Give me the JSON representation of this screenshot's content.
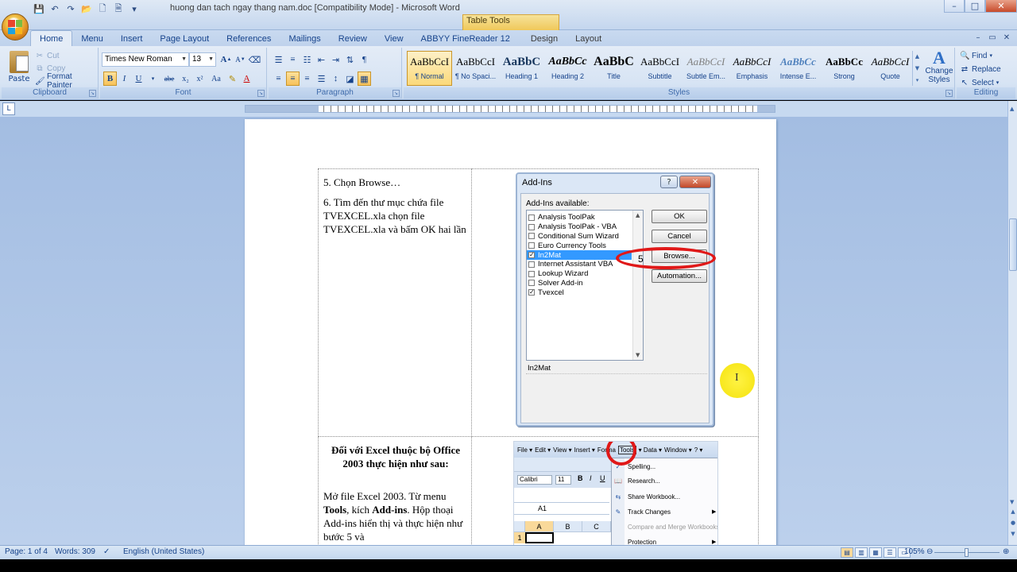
{
  "window": {
    "title": "huong dan tach ngay thang nam.doc [Compatibility Mode] - Microsoft Word",
    "contextual_tab_group": "Table Tools",
    "controls": [
      "–",
      "□",
      "✕"
    ]
  },
  "tabs": [
    {
      "label": "Home",
      "active": true
    },
    {
      "label": "Menu"
    },
    {
      "label": "Insert"
    },
    {
      "label": "Page Layout"
    },
    {
      "label": "References"
    },
    {
      "label": "Mailings"
    },
    {
      "label": "Review"
    },
    {
      "label": "View"
    },
    {
      "label": "ABBYY FineReader 12"
    },
    {
      "label": "Design",
      "contextual": true
    },
    {
      "label": "Layout",
      "contextual": true
    }
  ],
  "ribbon": {
    "clipboard": {
      "label": "Clipboard",
      "paste": "Paste",
      "cut": "Cut",
      "copy": "Copy",
      "format_painter": "Format Painter"
    },
    "font": {
      "label": "Font",
      "font_name": "Times New Roman",
      "font_size": "13",
      "bold": "B",
      "italic": "I",
      "underline": "U",
      "strike": "abe",
      "subscript": "x₂",
      "superscript": "x²",
      "change_case": "Aa",
      "grow": "A",
      "shrink": "A"
    },
    "paragraph": {
      "label": "Paragraph"
    },
    "styles": {
      "label": "Styles",
      "items": [
        {
          "sample": "AaBbCcI",
          "name": "¶ Normal",
          "active": true
        },
        {
          "sample": "AaBbCcI",
          "name": "¶ No Spaci..."
        },
        {
          "sample": "AaBbC",
          "name": "Heading 1"
        },
        {
          "sample": "AaBbCc",
          "name": "Heading 2"
        },
        {
          "sample": "AaBbC",
          "name": "Title"
        },
        {
          "sample": "AaBbCcI",
          "name": "Subtitle"
        },
        {
          "sample": "AaBbCcI",
          "name": "Subtle Em..."
        },
        {
          "sample": "AaBbCcI",
          "name": "Emphasis"
        },
        {
          "sample": "AaBbCc",
          "name": "Intense E..."
        },
        {
          "sample": "AaBbCc",
          "name": "Strong"
        },
        {
          "sample": "AaBbCcI",
          "name": "Quote"
        }
      ],
      "change_styles": "Change Styles"
    },
    "editing": {
      "label": "Editing",
      "find": "Find",
      "replace": "Replace",
      "select": "Select"
    }
  },
  "document": {
    "row1_left": {
      "step5": "5.  Chọn Browse…",
      "step6": "6.  Tìm đến thư mục chứa file TVEXCEL.xla chọn file TVEXCEL.xla và bấm OK hai lần"
    },
    "row2_left": {
      "heading": "Đối với Excel thuộc bộ Office 2003 thực hiện như sau:",
      "body_prefix": "Mở file Excel 2003. Từ menu ",
      "tools": "Tools",
      "body_mid": ", kích ",
      "addins": "Add-ins",
      "body_suffix": ". Hộp thoại Add-ins hiển thị và thực hiện như bước 5 và"
    }
  },
  "addins_dialog": {
    "title": "Add-Ins",
    "help": "?",
    "close": "✕",
    "available_label": "Add-Ins available:",
    "items": [
      {
        "name": "Analysis ToolPak",
        "checked": false
      },
      {
        "name": "Analysis ToolPak - VBA",
        "checked": false
      },
      {
        "name": "Conditional Sum Wizard",
        "checked": false
      },
      {
        "name": "Euro Currency Tools",
        "checked": false
      },
      {
        "name": "In2Mat",
        "checked": true,
        "selected": true
      },
      {
        "name": "Internet Assistant VBA",
        "checked": false
      },
      {
        "name": "Lookup Wizard",
        "checked": false
      },
      {
        "name": "Solver Add-in",
        "checked": false
      },
      {
        "name": "Tvexcel",
        "checked": true
      }
    ],
    "buttons": {
      "ok": "OK",
      "cancel": "Cancel",
      "browse": "Browse...",
      "automation": "Automation..."
    },
    "description": "In2Mat",
    "annotation": "5"
  },
  "excel_snippet": {
    "menu": [
      "File ▾",
      "Edit ▾",
      "View ▾",
      "Insert ▾",
      "Forma",
      "Tools",
      "▾ Data ▾",
      "Window ▾",
      "? ▾"
    ],
    "font": "Calibri",
    "size": "11",
    "bold": "B",
    "italic": "I",
    "underline": "U",
    "namebox": "A1",
    "columns": [
      "A",
      "B",
      "C"
    ],
    "row": "1",
    "tools_menu": [
      {
        "label": "Spelling...",
        "disabled": false,
        "icon": "abc"
      },
      {
        "label": "Research...",
        "disabled": false,
        "icon": "book"
      },
      {
        "label": "Share Workbook...",
        "disabled": false,
        "icon": "share"
      },
      {
        "label": "Track Changes",
        "disabled": false,
        "submenu": true,
        "icon": "track"
      },
      {
        "label": "Compare and Merge Workbooks...",
        "disabled": true
      },
      {
        "label": "Protection",
        "disabled": false,
        "submenu": true
      }
    ]
  },
  "statusbar": {
    "page": "Page: 1 of 4",
    "words": "Words: 309",
    "language": "English (United States)",
    "zoom": "105%"
  },
  "colors": {
    "ribbon_text": "#15428b",
    "workspace_bg": "#a3bde2",
    "annotation_red": "#e01818",
    "cursor_highlight": "#f4e100",
    "selected_item": "#3399ff"
  }
}
